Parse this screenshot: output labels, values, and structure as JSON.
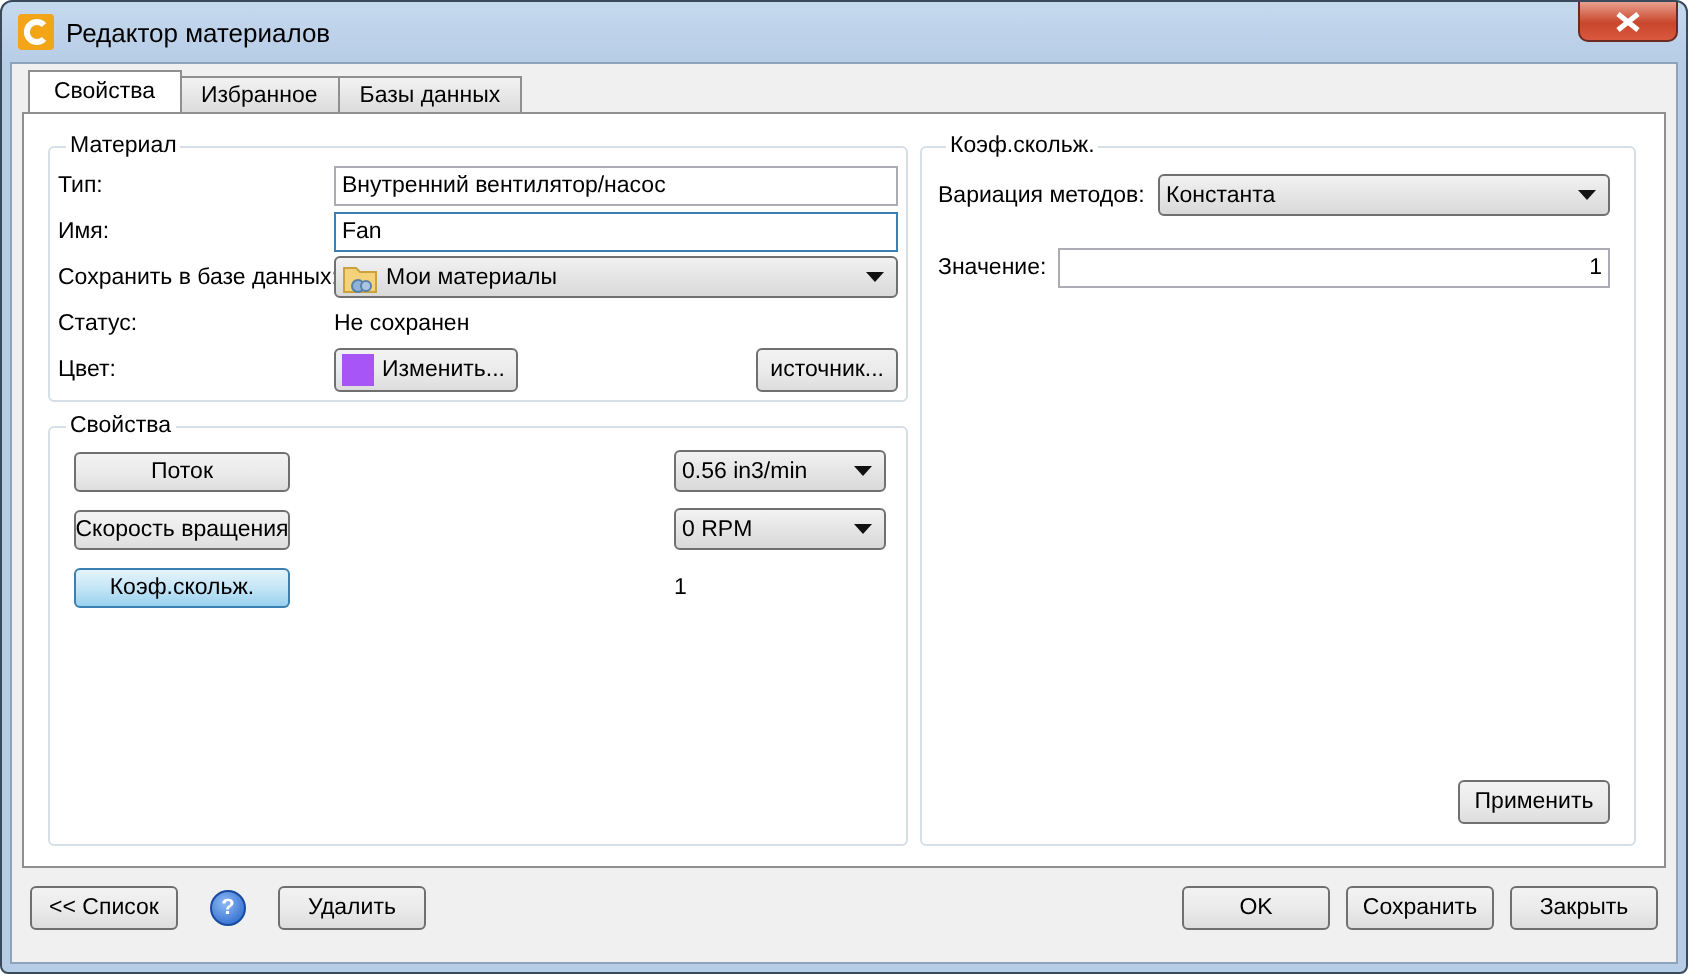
{
  "window": {
    "title": "Редактор материалов"
  },
  "tabs": [
    {
      "label": "Свойства",
      "selected": true
    },
    {
      "label": "Избранное",
      "selected": false
    },
    {
      "label": "Базы данных",
      "selected": false
    }
  ],
  "material": {
    "title": "Материал",
    "fields": [
      {
        "kind": "text",
        "label": "Тип:",
        "value": "Внутренний вентилятор/насос",
        "focused": false
      },
      {
        "kind": "text",
        "label": "Имя:",
        "value": "Fan",
        "focused": true
      },
      {
        "kind": "dropdown",
        "label": "Сохранить в базе данных:",
        "value": "Мои материалы"
      },
      {
        "kind": "static",
        "label": "Статус:",
        "value": "Не сохранен"
      },
      {
        "kind": "color",
        "label": "Цвет:",
        "button": "Изменить...",
        "color": "#a855f7",
        "extra_button": "источник..."
      }
    ]
  },
  "properties": {
    "title": "Свойства",
    "rows": [
      {
        "button": "Поток",
        "selected": false,
        "kind": "dropdown",
        "value": "0.56 in3/min"
      },
      {
        "button": "Скорость вращения",
        "selected": false,
        "kind": "dropdown",
        "value": "0 RPM"
      },
      {
        "button": "Коэф.скольж.",
        "selected": true,
        "kind": "static",
        "value": "1"
      }
    ]
  },
  "detail": {
    "title": "Коэф.скольж.",
    "method_label": "Вариация методов:",
    "method": "Константа",
    "value_label": "Значение:",
    "value": "1",
    "apply": "Применить"
  },
  "footer": {
    "list_button": "<< Список",
    "help": "?",
    "delete_button": "Удалить",
    "buttons": [
      "OK",
      "Сохранить",
      "Закрыть"
    ]
  }
}
